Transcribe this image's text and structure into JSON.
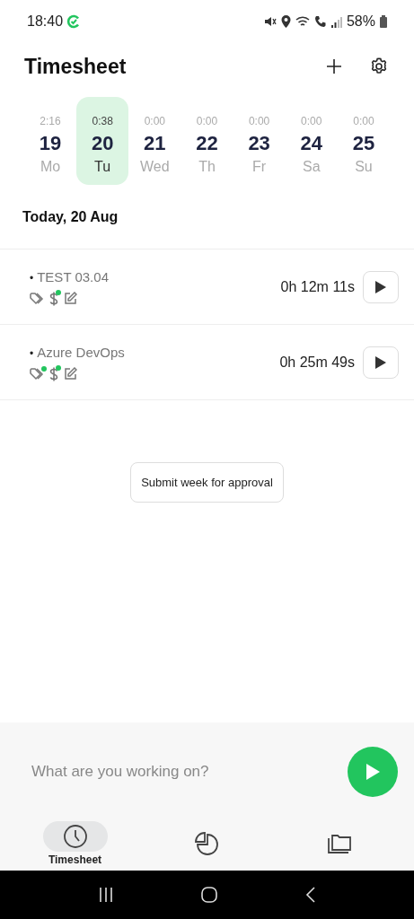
{
  "status_bar": {
    "time": "18:40",
    "battery": "58%"
  },
  "header": {
    "title": "Timesheet"
  },
  "days": [
    {
      "hours": "2:16",
      "date": "19",
      "weekday": "Mo",
      "selected": false
    },
    {
      "hours": "0:38",
      "date": "20",
      "weekday": "Tu",
      "selected": true
    },
    {
      "hours": "0:00",
      "date": "21",
      "weekday": "Wed",
      "selected": false
    },
    {
      "hours": "0:00",
      "date": "22",
      "weekday": "Th",
      "selected": false
    },
    {
      "hours": "0:00",
      "date": "23",
      "weekday": "Fr",
      "selected": false
    },
    {
      "hours": "0:00",
      "date": "24",
      "weekday": "Sa",
      "selected": false
    },
    {
      "hours": "0:00",
      "date": "25",
      "weekday": "Su",
      "selected": false
    }
  ],
  "section_title": "Today, 20 Aug",
  "entries": [
    {
      "bullet": "•",
      "project": "TEST 03.04",
      "tagged": false,
      "billable": true,
      "duration": "0h 12m 11s"
    },
    {
      "bullet": "•",
      "project": "Azure DevOps",
      "tagged": true,
      "billable": true,
      "duration": "0h 25m 49s"
    }
  ],
  "submit_button": "Submit week for approval",
  "timer": {
    "placeholder": "What are you working on?"
  },
  "nav": [
    {
      "kind": "timesheet",
      "label": "Timesheet",
      "selected": true
    },
    {
      "kind": "reports",
      "selected": false
    },
    {
      "kind": "projects",
      "selected": false
    }
  ]
}
